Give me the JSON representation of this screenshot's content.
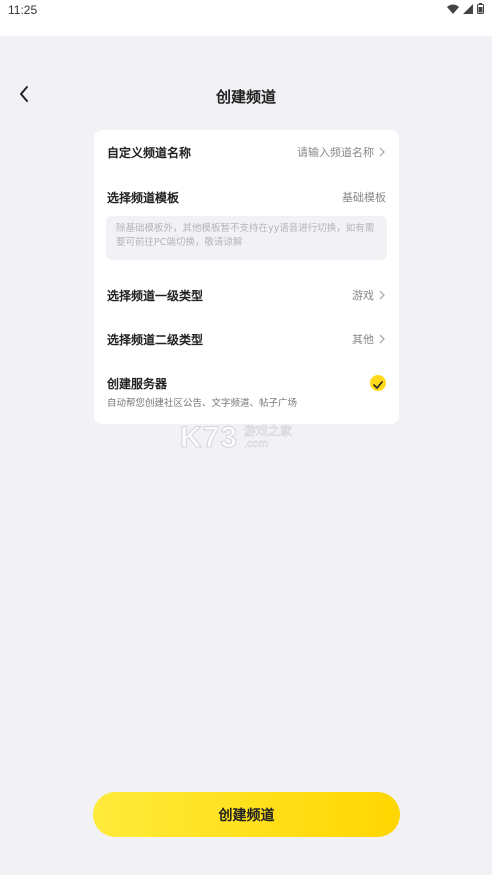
{
  "status_bar": {
    "time": "11:25"
  },
  "header": {
    "title": "创建频道"
  },
  "form": {
    "channel_name": {
      "label": "自定义频道名称",
      "placeholder": "请输入频道名称"
    },
    "template": {
      "label": "选择频道模板",
      "value": "基础模板"
    },
    "notice": "除基础模板外，其他模板暂不支持在yy语音进行切换，如有需要可前往PC端切换，敬请谅解",
    "primary_type": {
      "label": "选择频道一级类型",
      "value": "游戏"
    },
    "secondary_type": {
      "label": "选择频道二级类型",
      "value": "其他"
    },
    "server": {
      "label": "创建服务器",
      "description": "自动帮您创建社区公告、文字频道、帖子广场",
      "checked": true
    }
  },
  "watermark": {
    "logo": "K73",
    "line1": "游戏之家",
    "line2": ".com"
  },
  "footer": {
    "button_label": "创建频道"
  },
  "colors": {
    "accent": "#ffd91a",
    "background": "#f2f2f6"
  }
}
